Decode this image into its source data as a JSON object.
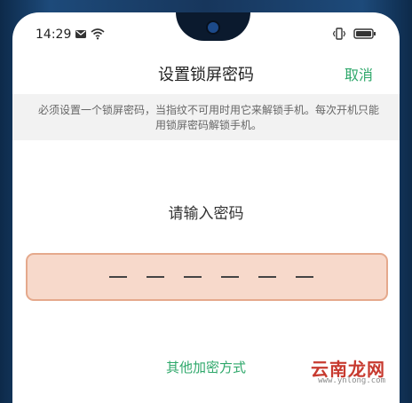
{
  "status_bar": {
    "time": "14:29",
    "icons": [
      "mail-icon",
      "wifi-icon",
      "vibrate-icon",
      "battery-icon"
    ]
  },
  "header": {
    "title": "设置锁屏密码",
    "cancel_label": "取消"
  },
  "notice": {
    "text": "必须设置一个锁屏密码，当指纹不可用时用它来解锁手机。每次开机只能用锁屏密码解锁手机。"
  },
  "password": {
    "prompt": "请输入密码",
    "digits": 6,
    "entered": 0
  },
  "other_methods_label": "其他加密方式",
  "watermark": {
    "main": "云南龙网",
    "sub": "www.ynlong.com"
  },
  "colors": {
    "accent": "#2fa86b",
    "field_bg": "#f7d9cb",
    "field_border": "#e5a98c",
    "notice_bg": "#f2f2f2"
  }
}
